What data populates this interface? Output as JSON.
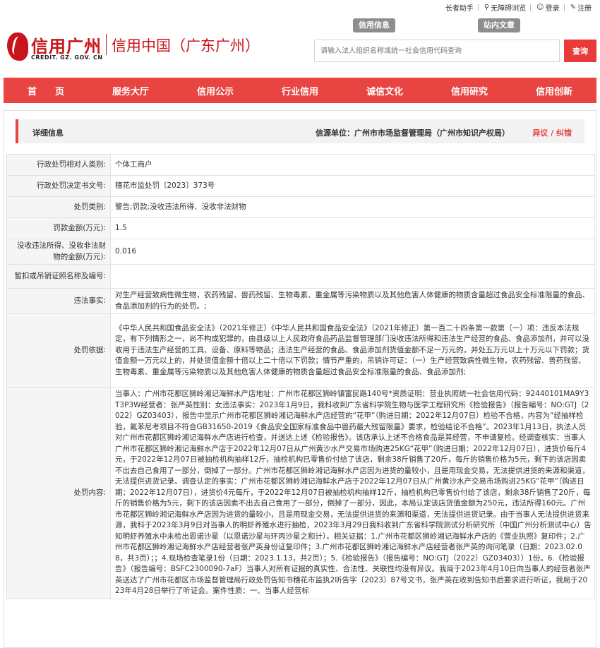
{
  "topbar": {
    "elder_mode": "长者助手",
    "accessible": "无障碍浏览",
    "login": "登录",
    "register": "注册"
  },
  "header": {
    "logo_cn": "信用广州",
    "logo_en": "CREDIT. GZ. GOV. CN",
    "site_title": "信用中国（广东广州）",
    "tab_credit_info": "信用信息",
    "tab_site_search": "站内文章",
    "search_placeholder": "请输入法人组织名称或统一社会信用代码查询",
    "search_button": "查询"
  },
  "nav": {
    "items": [
      "首　　页",
      "服务大厅",
      "信用公示",
      "行业信用",
      "诚信文化",
      "信用研究",
      "信用创新"
    ]
  },
  "detail": {
    "title": "详细信息",
    "source": "信源单位：广州市市场监督管理局（广州市知识产权局）",
    "error_report": "异议 / 纠错"
  },
  "rows": [
    {
      "label": "行政处罚相对人类别:",
      "value": "个体工商户"
    },
    {
      "label": "行政处罚决定书文号:",
      "value": "穗花市监处罚〔2023〕373号"
    },
    {
      "label": "处罚类别:",
      "value": "警告;罚款;没收违法所得、没收非法财物"
    },
    {
      "label": "罚款金额(万元):",
      "value": "1.5"
    },
    {
      "label": "没收违法所得、没收非法财物的金额(万元):",
      "value": "0.016"
    },
    {
      "label": "暂扣或吊销证照名称及编号:",
      "value": ""
    },
    {
      "label": "违法事实:",
      "value": "对生产经营致病性微生物，农药残留、兽药残留、生物毒素、重金属等污染物质以及其他危害人体健康的物质含量超过食品安全标准限量的食品、食品添加剂的行为的处罚。;"
    },
    {
      "label": "处罚依据:",
      "value": "《中华人民共和国食品安全法》（2021年修正）《中华人民共和国食品安全法》（2021年修正）第一百二十四条第一款第（一）项：违反本法规定，有下列情形之一，尚不构成犯罪的，由县级以上人民政府食品药品监督管理部门没收违法所得和违法生产经营的食品、食品添加剂，并可以没收用于违法生产经营的工具、设备、原料等物品；违法生产经营的食品、食品添加剂货值金额不足一万元的，并处五万元以上十万元以下罚款；货值金额一万元以上的，并处货值金额十倍以上二十倍以下罚款；情节严重的，吊销许可证：（一）生产经营致病性微生物，农药残留、兽药残留、生物毒素、重金属等污染物质以及其他危害人体健康的物质含量超过食品安全标准限量的食品、食品添加剂;"
    },
    {
      "label": "处罚内容:",
      "value": "当事人：广州市花都区狮岭湘记海鲜水产店地址：广州市花都区狮岭镇富民路140号*资质证明：营业执照统一社会信用代码：92440101MA9Y3T3P3W经营者：张严英性别：女违法事实：2023年1月9日，我科收到广东省科学院生物与医学工程研究所《检验报告》（报告编号：NO:GTJ（2022）GZ03403），报告中显示广州市花都区狮岭湘记海鲜水产店经营的“花甲”（购进日期：2022年12月07日）检验不合格，内容为“经抽样检验，氟苯尼考项目不符合GB31650-2019《食品安全国家标准食品中兽药最大残留限量》要求，检验结论不合格”。2023年1月13日，执法人员对广州市花都区狮岭湘记海鲜水产店进行检查，并送达上述《检验报告》。该店承认上述不合格食品是其经营，不申请复检。经调查核实：当事人广州市花都区狮岭湘记海鲜水产店于2022年12月07日从广州黄沙水产交易市场购进25KG“花甲”（购进日期：2022年12月07日），进货价每斤4元，于2022年12月07日被抽检机构抽样12斤，抽检机构已零售价付给了该店，剩余38斤销售了20斤，每斤的销售价格为5元，剩下的该店因卖不出去自己食用了一部分，倒掉了一部分。广州市花都区狮岭湘记海鲜水产店因为进货的量较小，且是用现金交易，无法提供进货的来源和渠道，无法提供进货记录。调查认定的事实：广州市花都区狮岭湘记海鲜水产店于2022年12月07日从广州黄沙水产交易市场购进25KG“花甲”（购进日期：2022年12月07日），进货价4元每斤，于2022年12月07日被抽检机构抽样12斤，抽检机构已零售价付给了该店，剩余38斤销售了20斤，每斤的销售价格为5元，剩下的该店因卖不出去自己食用了一部分，倒掉了一部分，因此，本局认定该店货值金额为250元，违法所得160元。广州市花都区狮岭湘记海鲜水产店因为进货的量较小，且是用现金交易，无法提供进货的来源和渠道，无法提供进货记录。由于当事人无法提供进货来源，我科于2023年3月9日对当事人的明虾养殖水进行抽检，2023年3月29日我科收到广东省科学院测试分析研究所（中国广州分析测试中心）告知明虾养殖水中未检出恩诺沙星（以恩诺沙星与环丙沙星之和计）。相关证据：1.广州市花都区狮岭湘记海鲜水产店的《营业执照》复印件；2.广州市花都区狮岭湘记海鲜水产店经营者张严英身份证复印件；3.广州市花都区狮岭湘记海鲜水产店经营者张严英的询问笔录（日期：2023.02.08，共3页）；；4.现场检查笔录1份（日期：2023.1.13，共2页）；5.《检验报告》（报告编号：NO:GTJ（2022）GZ03403））1份。6.《检验报告》（报告编号：BSFC2300090-7aF）当事人对所有证据的真实性、合法性、关联性均没有异议。我局于2023年4月10日向当事人的经营者张严英送达了广州市花都区市场监督管理局行政处罚告知书穗花市监执2听告字〔2023〕87号文书，张严英在收到告知书后要求进行听证，我局于2023年4月28日举行了听证会。案件性质：一、当事人经营标"
    }
  ]
}
